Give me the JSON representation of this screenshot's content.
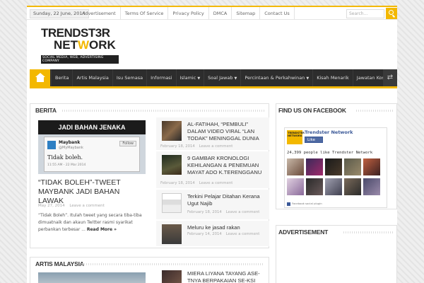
{
  "topbar": {
    "date": "Sunday, 22 June, 2014",
    "links": [
      "Advertisement",
      "Terms Of Service",
      "Privacy Policy",
      "DMCA",
      "Sitemap",
      "Contact Us"
    ],
    "search_placeholder": "Search..."
  },
  "logo": {
    "line1": "TRENDST3R",
    "line2_a": "NET",
    "line2_b": "W",
    "line2_c": "ORK",
    "tagline": "SOCIAL MEDIA, WEB, ADVERTISING COMPANY"
  },
  "nav": {
    "items": [
      {
        "label": "Berita",
        "dropdown": false
      },
      {
        "label": "Artis Malaysia",
        "dropdown": false
      },
      {
        "label": "Isu Semasa",
        "dropdown": false
      },
      {
        "label": "Informasi",
        "dropdown": false
      },
      {
        "label": "Islamic",
        "dropdown": true
      },
      {
        "label": "Soal Jawab",
        "dropdown": true
      },
      {
        "label": "Percintaan & Perkahwinan",
        "dropdown": true
      },
      {
        "label": "Kisah Menarik",
        "dropdown": false
      },
      {
        "label": "Jawatan Kosong",
        "dropdown": true
      }
    ],
    "caret": "▼",
    "shuffle_icon": "⇄"
  },
  "berita": {
    "title": "BERITA",
    "featured": {
      "image_banner": "JADI BAHAN JENAKA",
      "tweet_name": "Maybank",
      "tweet_handle": "@MyMaybank",
      "tweet_follow": "Follow",
      "tweet_text": "Tidak boleh.",
      "tweet_date": "11:55 AM - 22 Mar 2014",
      "title": "“TIDAK BOLEH”-TWEET MAYBANK JADI BAHAN LAWAK",
      "date": "May 27, 2014",
      "comment": "Leave a comment",
      "excerpt": "“Tidak Boleh”. Itulah tweet yang secara tiba-tiba dimuatnaik dan akaun Twitter rasmi syarikat perbankan terbesar ...",
      "read_more": "Read More »"
    },
    "posts": [
      {
        "title": "AL-FATIHAH, “PEMBULI” DALAM VIDEO VIRAL “LAN TODAK” MENINGGAL DUNIA",
        "date": "February 18, 2014",
        "comment": "Leave a comment"
      },
      {
        "title": "9 GAMBAR KRONOLOGI KEHILANGAN & PENEMUAN MAYAT ADO K.TERENGGANU",
        "date": "February 18, 2014",
        "comment": "Leave a comment"
      },
      {
        "title": "Terkini Pelajar Ditahan Kerana Ugut Najib",
        "date": "February 18, 2014",
        "comment": "Leave a comment"
      },
      {
        "title": "Meluru ke jasad rakan",
        "date": "February 14, 2014",
        "comment": "Leave a comment"
      }
    ]
  },
  "artis": {
    "title": "ARTIS MALAYSIA",
    "post_title": "MIERA LIYANA TAYANG ASE-TNYA BERPAKAIAN SE-KSI"
  },
  "sidebar": {
    "facebook_title": "FIND US ON FACEBOOK",
    "fb_page_logo": "TRENDSTER NETWORK",
    "fb_page_name": "Trendster Network",
    "fb_like": "Like",
    "fb_count_text": "24,399 people like Trendster Network",
    "fb_faces": [
      "",
      "",
      "",
      "",
      "",
      "",
      "",
      "",
      "",
      ""
    ],
    "fb_plugin": "Facebook social plugin",
    "advert_title": "ADVERTISEMENT"
  },
  "colors": {
    "accent": "#f3b800",
    "nav_bg": "#2d2d2d",
    "facebook": "#3b5998"
  }
}
